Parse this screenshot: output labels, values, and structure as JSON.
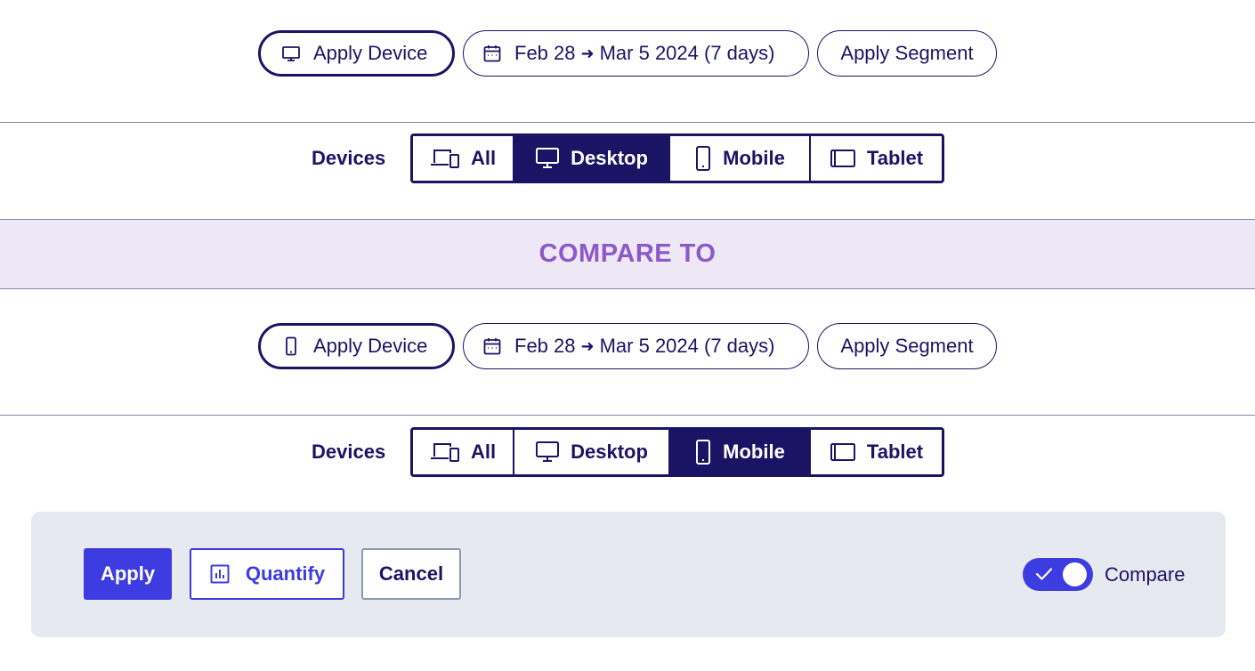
{
  "primary": {
    "device_button_label": "Apply Device",
    "date_range": {
      "start": "Feb 28",
      "arrow": "➜",
      "end": "Mar 5 2024 (7 days)"
    },
    "segment_button_label": "Apply Segment",
    "devices": {
      "label": "Devices",
      "options": [
        {
          "label": "All",
          "icon": "devices-icon"
        },
        {
          "label": "Desktop",
          "icon": "desktop-icon"
        },
        {
          "label": "Mobile",
          "icon": "mobile-icon"
        },
        {
          "label": "Tablet",
          "icon": "tablet-icon"
        }
      ],
      "selected": "Desktop"
    }
  },
  "compare_banner": "COMPARE TO",
  "comparison": {
    "device_button_label": "Apply Device",
    "date_range": {
      "start": "Feb 28",
      "arrow": "➜",
      "end": "Mar 5 2024 (7 days)"
    },
    "segment_button_label": "Apply Segment",
    "devices": {
      "label": "Devices",
      "options": [
        {
          "label": "All",
          "icon": "devices-icon"
        },
        {
          "label": "Desktop",
          "icon": "desktop-icon"
        },
        {
          "label": "Mobile",
          "icon": "mobile-icon"
        },
        {
          "label": "Tablet",
          "icon": "tablet-icon"
        }
      ],
      "selected": "Mobile"
    }
  },
  "footer": {
    "apply_label": "Apply",
    "quantify_label": "Quantify",
    "cancel_label": "Cancel",
    "compare_toggle": {
      "label": "Compare",
      "on": true
    }
  },
  "colors": {
    "navy": "#1b1464",
    "accent_blue": "#3c3ce0",
    "compare_band_bg": "#ede7f6",
    "compare_band_text": "#8c5ac8",
    "footer_bg": "#e6e9ef"
  }
}
